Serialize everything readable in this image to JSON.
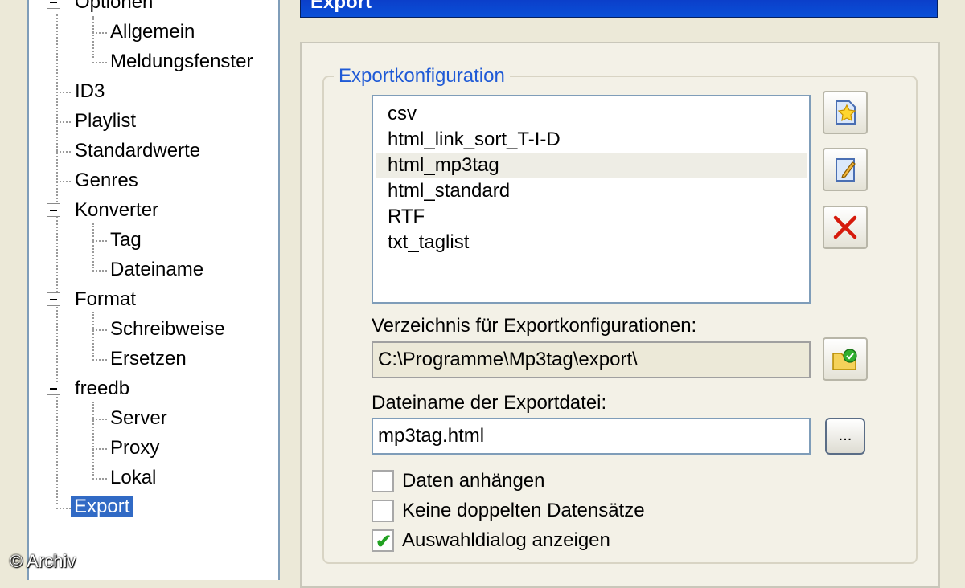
{
  "panel_title": "Export",
  "tree": {
    "items": [
      {
        "label": "Optionen"
      },
      {
        "label": "Allgemein"
      },
      {
        "label": "Meldungsfenster"
      },
      {
        "label": "ID3"
      },
      {
        "label": "Playlist"
      },
      {
        "label": "Standardwerte"
      },
      {
        "label": "Genres"
      },
      {
        "label": "Konverter"
      },
      {
        "label": "Tag"
      },
      {
        "label": "Dateiname"
      },
      {
        "label": "Format"
      },
      {
        "label": "Schreibweise"
      },
      {
        "label": "Ersetzen"
      },
      {
        "label": "freedb"
      },
      {
        "label": "Server"
      },
      {
        "label": "Proxy"
      },
      {
        "label": "Lokal"
      },
      {
        "label": "Export"
      }
    ],
    "selected": "Export"
  },
  "export_config": {
    "group_title": "Exportkonfiguration",
    "list": [
      "csv",
      "html_link_sort_T-I-D",
      "html_mp3tag",
      "html_standard",
      "RTF",
      "txt_taglist"
    ],
    "selected": "html_mp3tag",
    "dir_label": "Verzeichnis für Exportkonfigurationen:",
    "dir_value": "C:\\Programme\\Mp3tag\\export\\",
    "file_label": "Dateiname der Exportdatei:",
    "file_value": "mp3tag.html",
    "browse_label": "...",
    "checkboxes": [
      {
        "label": "Daten anhängen",
        "checked": false
      },
      {
        "label": "Keine doppelten Datensätze",
        "checked": false
      },
      {
        "label": "Auswahldialog anzeigen",
        "checked": true
      }
    ]
  },
  "icons": {
    "new": "new-config-icon",
    "edit": "edit-config-icon",
    "delete": "delete-icon",
    "folder": "folder-select-icon"
  },
  "watermark": "© Archiv"
}
